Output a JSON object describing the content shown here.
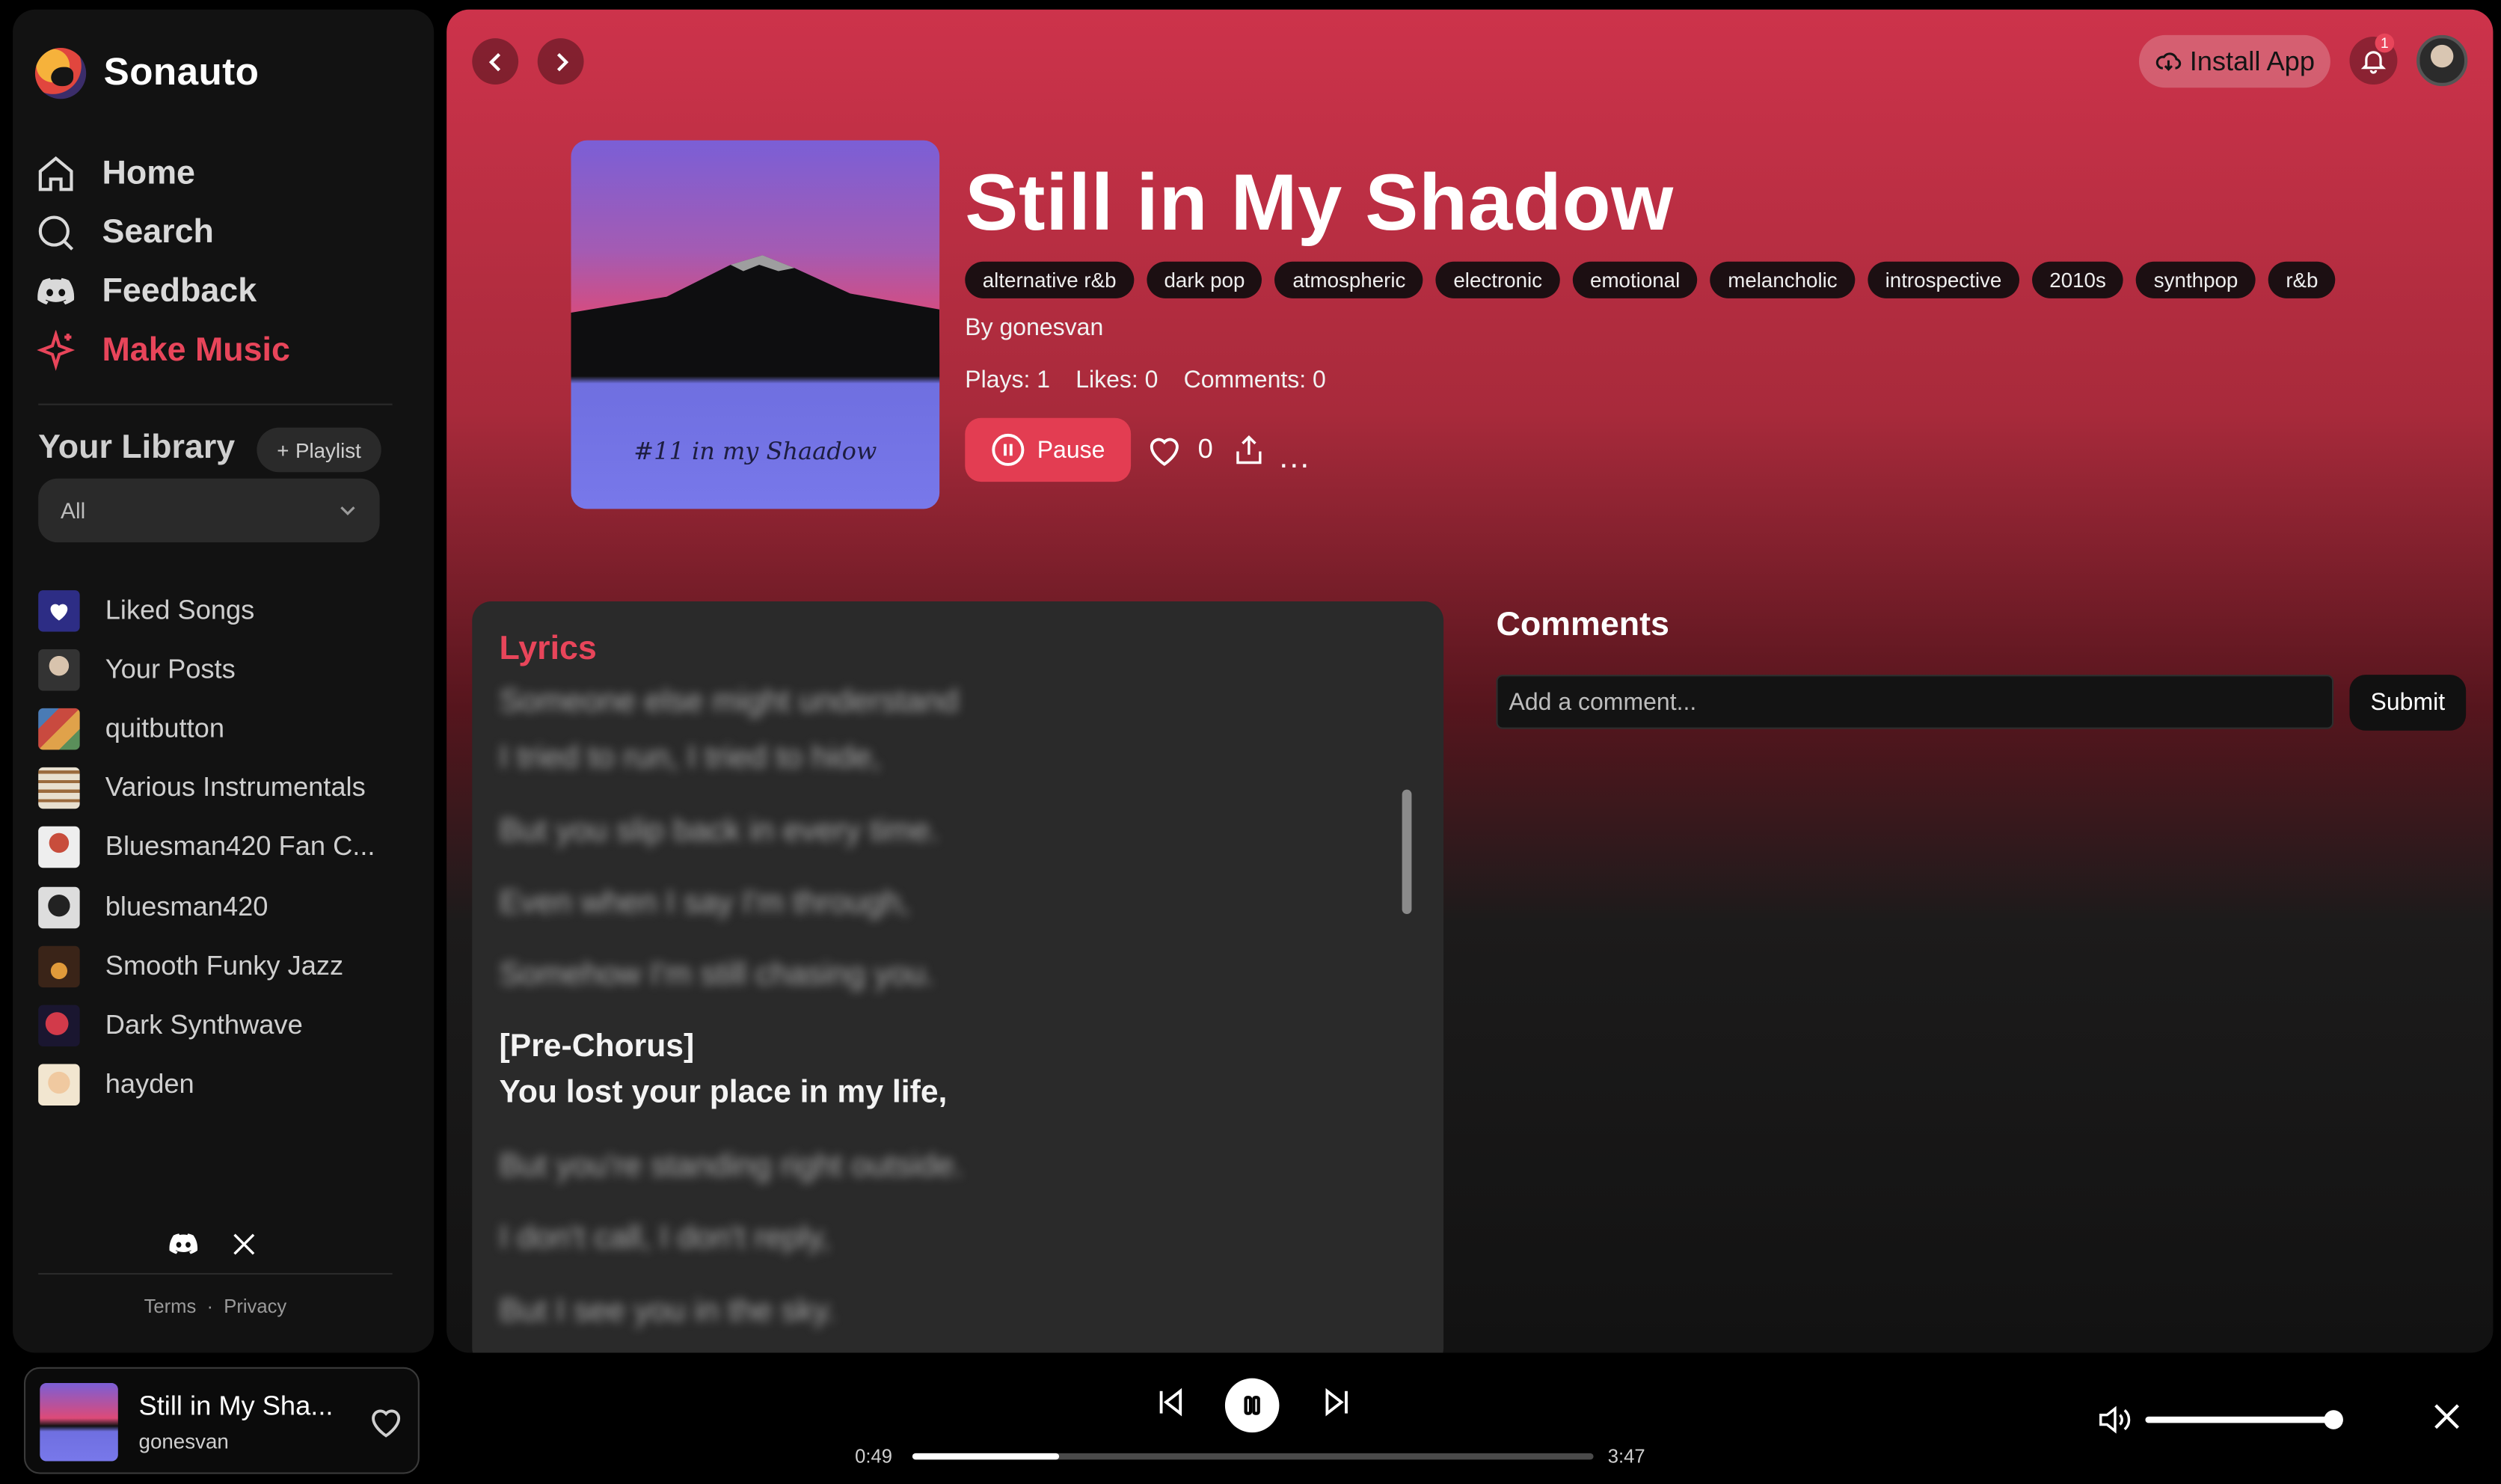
{
  "brand": {
    "name": "Sonauto"
  },
  "nav": [
    {
      "label": "Home",
      "icon": "home-icon"
    },
    {
      "label": "Search",
      "icon": "search-icon"
    },
    {
      "label": "Feedback",
      "icon": "discord-icon"
    },
    {
      "label": "Make Music",
      "icon": "sparkle-icon"
    }
  ],
  "library": {
    "title": "Your Library",
    "playlist_button": "Playlist",
    "filter_value": "All",
    "items": [
      {
        "label": "Liked Songs",
        "icon": "heart-icon"
      },
      {
        "label": "Your Posts"
      },
      {
        "label": "quitbutton"
      },
      {
        "label": "Various Instrumentals"
      },
      {
        "label": "Bluesman420 Fan C..."
      },
      {
        "label": "bluesman420"
      },
      {
        "label": "Smooth Funky Jazz"
      },
      {
        "label": "Dark Synthwave"
      },
      {
        "label": "hayden"
      }
    ]
  },
  "footer": {
    "terms": "Terms",
    "separator": "·",
    "privacy": "Privacy"
  },
  "topbar": {
    "install_label": "Install App",
    "notifications": "1"
  },
  "song": {
    "title": "Still in My Shadow",
    "cover_text": "#11 in my Shaadow",
    "tags": [
      "alternative r&b",
      "dark pop",
      "atmospheric",
      "electronic",
      "emotional",
      "melancholic",
      "introspective",
      "2010s",
      "synthpop",
      "r&b"
    ],
    "byline": "By gonesvan",
    "plays": "Plays: 1",
    "likes": "Likes: 0",
    "comments": "Comments: 0",
    "pause_label": "Pause",
    "like_count": "0",
    "more": "..."
  },
  "lyrics": {
    "title": "Lyrics",
    "lines": [
      {
        "text": "Someone else might understand",
        "active": false
      },
      {
        "text": "I tried to run, I tried to hide,",
        "active": false
      },
      {
        "text": "But you slip back in every time.",
        "active": false
      },
      {
        "text": "Even when I say I'm through,",
        "active": false
      },
      {
        "text": "Somehow I'm still chasing you.",
        "active": false
      },
      {
        "text": "[Pre-Chorus]",
        "active": true
      },
      {
        "text": "You lost your place in my life,",
        "active": true
      },
      {
        "text": "But you're standing right outside.",
        "active": false
      },
      {
        "text": "I don't call, I don't reply,",
        "active": false
      },
      {
        "text": "But I see you in the sky.",
        "active": false
      }
    ]
  },
  "comments": {
    "title": "Comments",
    "placeholder": "Add a comment...",
    "submit_label": "Submit"
  },
  "player": {
    "title": "Still in My Sha...",
    "artist": "gonesvan",
    "elapsed": "0:49",
    "duration": "3:47",
    "progress": 0.216,
    "volume": 1.0
  },
  "colors": {
    "accent": "#e8455a",
    "hero_top": "#cd334b",
    "panel": "#121212"
  }
}
